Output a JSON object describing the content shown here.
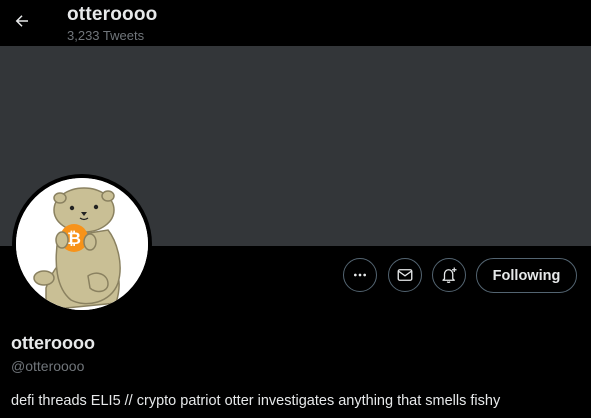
{
  "header": {
    "title": "otteroooo",
    "tweet_count": "3,233 Tweets",
    "back_icon": "arrow-left-icon"
  },
  "banner": {
    "color": "#333639"
  },
  "profile": {
    "avatar": "otter-holding-bitcoin",
    "name": "otteroooo",
    "handle": "@otteroooo",
    "bio": "defi threads ELI5 // crypto patriot otter investigates anything that smells fishy"
  },
  "actions": {
    "more_icon": "more-horizontal-icon",
    "message_icon": "envelope-icon",
    "notify_icon": "bell-plus-icon",
    "follow_label": "Following"
  },
  "colors": {
    "background": "#000000",
    "text_primary": "#e7e9ea",
    "text_secondary": "#71767b",
    "button_border": "#536471",
    "bitcoin_orange": "#f7931a",
    "otter_fur": "#c9bf95"
  }
}
